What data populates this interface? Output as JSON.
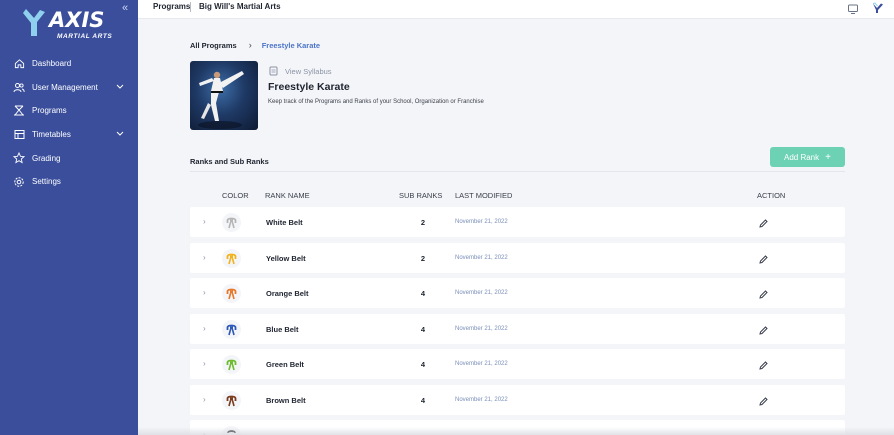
{
  "sidebar": {
    "logo_text": "AXIS",
    "logo_subtitle": "MARTIAL ARTS",
    "items": [
      {
        "label": "Dashboard",
        "icon": "home-icon"
      },
      {
        "label": "User Management",
        "icon": "users-icon",
        "has_chevron": true
      },
      {
        "label": "Programs",
        "icon": "programs-icon"
      },
      {
        "label": "Timetables",
        "icon": "table-icon",
        "has_chevron": true
      },
      {
        "label": "Grading",
        "icon": "star-icon"
      },
      {
        "label": "Settings",
        "icon": "gear-icon"
      }
    ]
  },
  "topbar": {
    "section": "Programs",
    "school": "Big Will's Martial Arts"
  },
  "breadcrumb": {
    "root": "All Programs",
    "current": "Freestyle Karate"
  },
  "program": {
    "view_syllabus": "View Syllabus",
    "title": "Freestyle Karate",
    "description": "Keep track of the Programs and Ranks of your School, Organization or Franchise"
  },
  "ranks": {
    "title": "Ranks and Sub Ranks",
    "add_button": "Add Rank",
    "columns": {
      "color": "COLOR",
      "rank_name": "RANK NAME",
      "sub_ranks": "SUB RANKS",
      "last_modified": "LAST MODIFIED",
      "action": "ACTION"
    },
    "rows": [
      {
        "name": "White Belt",
        "sub_ranks": "2",
        "modified": "November 21, 2022",
        "color": "#d8d8d8"
      },
      {
        "name": "Yellow Belt",
        "sub_ranks": "2",
        "modified": "November 21, 2022",
        "color": "#f2b21b"
      },
      {
        "name": "Orange Belt",
        "sub_ranks": "4",
        "modified": "November 21, 2022",
        "color": "#e8772a"
      },
      {
        "name": "Blue Belt",
        "sub_ranks": "4",
        "modified": "November 21, 2022",
        "color": "#2d58b8"
      },
      {
        "name": "Green Belt",
        "sub_ranks": "4",
        "modified": "November 21, 2022",
        "color": "#6dbb2e"
      },
      {
        "name": "Brown Belt",
        "sub_ranks": "4",
        "modified": "November 21, 2022",
        "color": "#7a3b1c"
      }
    ]
  },
  "colors": {
    "sidebar": "#3a4e9c",
    "accent": "#4b74c9",
    "add_button": "#6dd1b4"
  }
}
